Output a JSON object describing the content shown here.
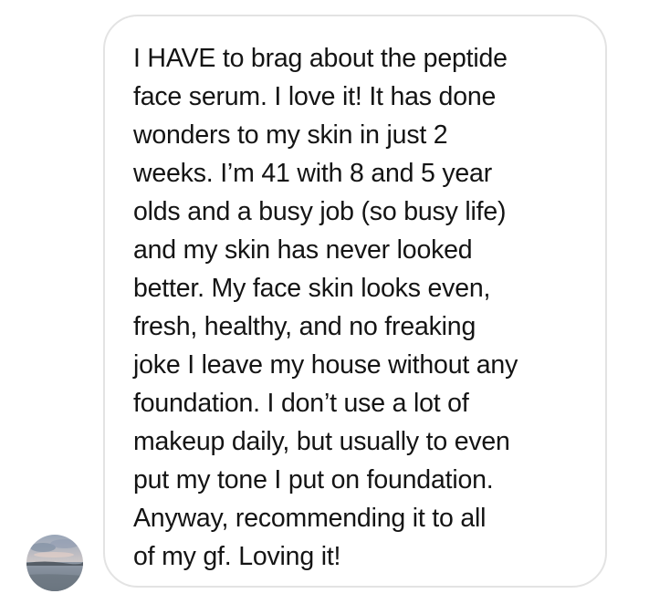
{
  "message": {
    "lines": [
      "I HAVE to brag about the peptide",
      "face serum. I love it! It has done",
      "wonders to my skin in just 2",
      "weeks. I’m 41 with 8 and 5 year",
      "olds and a busy job (so busy life)",
      "and my skin has never looked",
      "better. My face skin looks even,",
      "fresh, healthy, and no freaking",
      "joke I leave my house without any",
      "foundation. I don’t use a lot of",
      "makeup daily, but usually to even",
      "put my tone I put on foundation.",
      "Anyway, recommending it to all",
      "of my gf. Loving it!"
    ]
  },
  "colors": {
    "bubble_border": "#e3e3e3",
    "text": "#141414",
    "background": "#ffffff"
  }
}
